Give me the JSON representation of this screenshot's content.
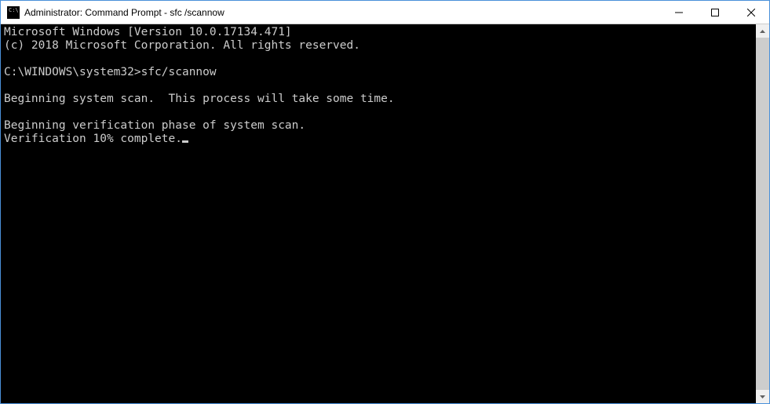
{
  "titlebar": {
    "title": "Administrator: Command Prompt - sfc  /scannow"
  },
  "terminal": {
    "lines": [
      "Microsoft Windows [Version 10.0.17134.471]",
      "(c) 2018 Microsoft Corporation. All rights reserved.",
      "",
      "C:\\WINDOWS\\system32>sfc/scannow",
      "",
      "Beginning system scan.  This process will take some time.",
      "",
      "Beginning verification phase of system scan.",
      "Verification 10% complete."
    ]
  }
}
